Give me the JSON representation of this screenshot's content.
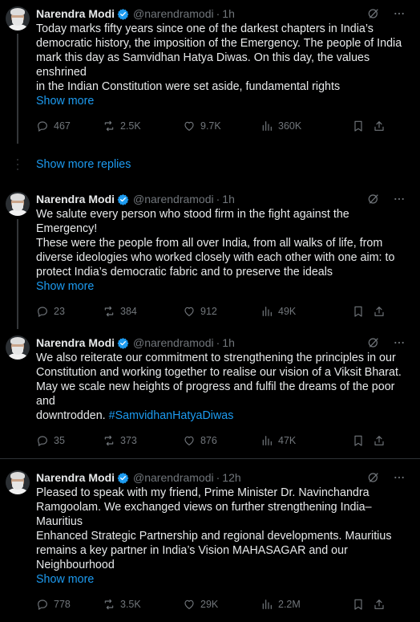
{
  "colors": {
    "background": "#000000",
    "text": "#e7e9ea",
    "muted": "#71767b",
    "accent": "#1d9bf0",
    "divider": "#2f3336"
  },
  "icons": {
    "verified": "verified-badge-icon",
    "grok": "grok-icon",
    "more": "more-icon",
    "reply": "reply-icon",
    "repost": "repost-icon",
    "like": "like-icon",
    "views": "views-icon",
    "bookmark": "bookmark-icon",
    "share": "share-icon"
  },
  "tweets": [
    {
      "name": "Narendra Modi",
      "handle": "@narendramodi",
      "dot": "·",
      "time": "1h",
      "text": "Today marks fifty years since one of the darkest chapters in India’s\ndemocratic history, the imposition of the Emergency. The people of India\nmark this day as Samvidhan Hatya Diwas. On this day, the values enshrined\nin the Indian Constitution were set aside, fundamental rights",
      "hashtag": "",
      "show_more": "Show more",
      "replies": "467",
      "reposts": "2.5K",
      "likes": "9.7K",
      "views": "360K"
    },
    {
      "name": "Narendra Modi",
      "handle": "@narendramodi",
      "dot": "·",
      "time": "1h",
      "text": "We salute every person who stood firm in the fight against the Emergency!\nThese were the people from all over India, from all walks of life, from\ndiverse ideologies who worked closely with each other with one aim: to\nprotect India’s democratic fabric and to preserve the ideals",
      "hashtag": "",
      "show_more": "Show more",
      "replies": "23",
      "reposts": "384",
      "likes": "912",
      "views": "49K"
    },
    {
      "name": "Narendra Modi",
      "handle": "@narendramodi",
      "dot": "·",
      "time": "1h",
      "text": "We also reiterate our commitment to strengthening the principles in our\nConstitution and working together to realise our vision of a Viksit Bharat.\nMay we scale new heights of progress and fulfil the dreams of the poor and\ndowntrodden. ",
      "hashtag": "#SamvidhanHatyaDiwas",
      "show_more": "",
      "replies": "35",
      "reposts": "373",
      "likes": "876",
      "views": "47K"
    },
    {
      "name": "Narendra Modi",
      "handle": "@narendramodi",
      "dot": "·",
      "time": "12h",
      "text": "Pleased to speak with my friend, Prime Minister Dr. Navinchandra\nRamgoolam. We exchanged views on further strengthening India–Mauritius\nEnhanced Strategic Partnership and regional developments. Mauritius\nremains a key partner in India’s Vision MAHASAGAR and our\nNeighbourhood",
      "hashtag": "",
      "show_more": "Show more",
      "replies": "778",
      "reposts": "3.5K",
      "likes": "29K",
      "views": "2.2M"
    }
  ],
  "show_more_replies": "Show more replies"
}
